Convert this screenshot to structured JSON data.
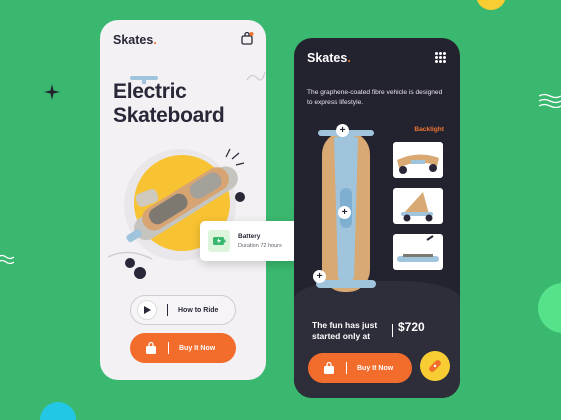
{
  "colors": {
    "background": "#3ab86f",
    "accent": "#f26d2c",
    "dark_card": "#23222f",
    "light_card": "#f3f1f3",
    "yellow": "#f8cd34"
  },
  "left_screen": {
    "brand": "Skates",
    "brand_dot": ".",
    "title_line1": "Electric",
    "title_line2": "Skateboard",
    "how_to_ride_label": "How to Ride",
    "buy_label": "Buy It Now",
    "icons": [
      "bag-icon",
      "play-icon",
      "shopping-bag-icon"
    ]
  },
  "battery_card": {
    "title": "Battery",
    "subtitle": "Duration 72 hours",
    "icon": "battery-icon"
  },
  "right_screen": {
    "brand": "Skates",
    "brand_dot": ".",
    "description": "The graphene-coated fibre vehicle is designed to express lifestyle.",
    "backlight_label": "Backlight",
    "tagline": "The fun has just started only at",
    "price": "$720",
    "buy_label": "Buy It Now",
    "icons": [
      "grid-menu-icon",
      "shopping-bag-icon",
      "bandage-icon"
    ]
  }
}
